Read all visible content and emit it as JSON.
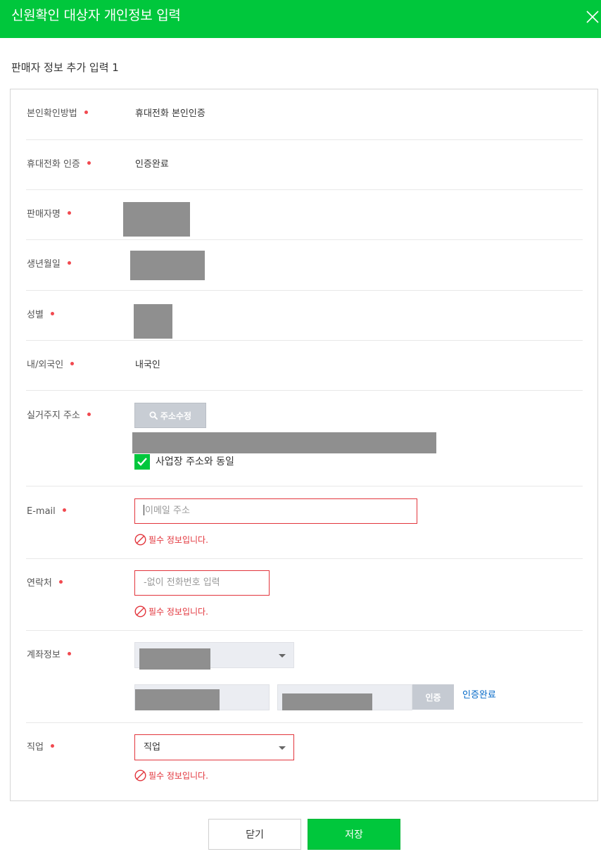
{
  "modal": {
    "title": "신원확인 대상자 개인정보 입력",
    "close_icon": "close-icon",
    "section_title": "판매자 정보 추가 입력 1"
  },
  "colors": {
    "brand": "#00c73c",
    "error": "#e2353c",
    "required_dot": "#f1494f",
    "link": "#0067c7"
  },
  "form": {
    "verification_method": {
      "label": "본인확인방법",
      "value": "휴대전화 본인인증"
    },
    "phone_auth": {
      "label": "휴대전화 인증",
      "value": "인증완료"
    },
    "seller_name": {
      "label": "판매자명"
    },
    "birthdate": {
      "label": "생년월일"
    },
    "gender": {
      "label": "성별"
    },
    "nationality": {
      "label": "내/외국인",
      "value": "내국인"
    },
    "address": {
      "label": "실거주지 주소",
      "button": "주소수정",
      "button_icon": "search-icon",
      "same_as_business": {
        "label": "사업장 주소와 동일",
        "checked": true
      }
    },
    "email": {
      "label": "E-mail",
      "placeholder": "이메일 주소",
      "error": "필수 정보입니다."
    },
    "contact": {
      "label": "연락처",
      "placeholder": "-없이 전화번호 입력",
      "error": "필수 정보입니다."
    },
    "account": {
      "label": "계좌정보",
      "verify_button": "인증",
      "verified_link": "인증완료"
    },
    "job": {
      "label": "직업",
      "selected": "직업",
      "error": "필수 정보입니다."
    }
  },
  "footer": {
    "close_label": "닫기",
    "save_label": "저장"
  }
}
